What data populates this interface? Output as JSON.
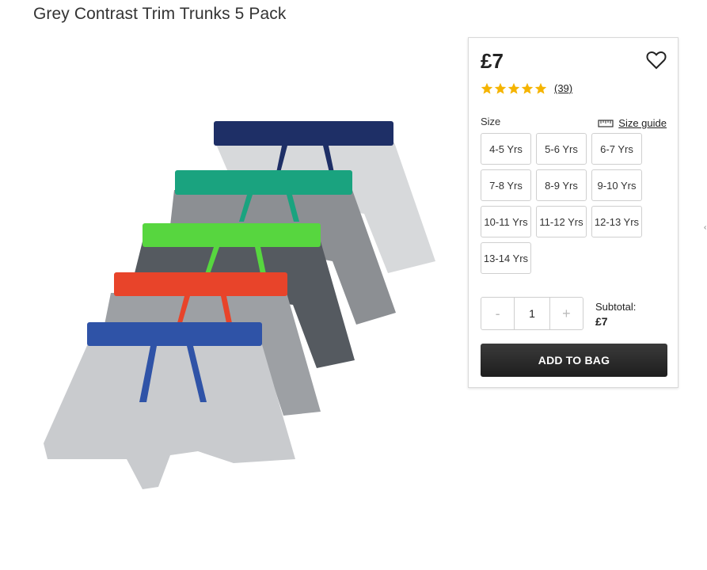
{
  "product": {
    "title": "Grey Contrast Trim Trunks 5 Pack"
  },
  "purchase": {
    "price": "£7",
    "rating": 5,
    "reviews": "(39)",
    "size_label": "Size",
    "size_guide": "Size guide",
    "sizes": [
      "4-5 Yrs",
      "5-6 Yrs",
      "6-7 Yrs",
      "7-8 Yrs",
      "8-9 Yrs",
      "9-10 Yrs",
      "10-11 Yrs",
      "11-12 Yrs",
      "12-13 Yrs",
      "13-14 Yrs"
    ],
    "quantity": {
      "minus": "-",
      "value": "1",
      "plus": "+"
    },
    "subtotal_label": "Subtotal:",
    "subtotal_value": "£7",
    "add_to_bag": "ADD TO BAG"
  },
  "colors": {
    "star": "#f5b400",
    "button": "#262626",
    "waistbands": [
      "#1e2f66",
      "#1aa37f",
      "#57d63f",
      "#e8442a",
      "#2f53a7"
    ]
  },
  "icons": [
    "heart-icon",
    "star-icon",
    "ruler-icon"
  ]
}
